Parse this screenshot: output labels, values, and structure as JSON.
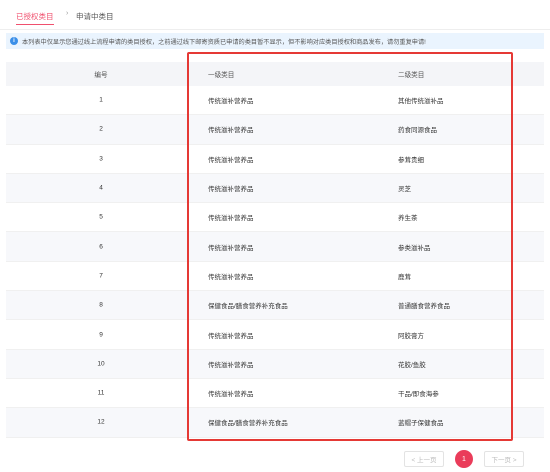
{
  "tabs": {
    "active_label": "已授权类目",
    "separator": "›",
    "inactive_label": "申请中类目"
  },
  "notice": {
    "icon": "info-icon",
    "text": "本列表中仅显示您通过线上流程申请的类目授权，之前通过线下邮寄资质已申请的类目暂不显示，但不影响对应类目授权和商品发布，请勿重复申请!"
  },
  "table": {
    "headers": {
      "id": "编号",
      "level1": "一级类目",
      "level2": "二级类目"
    },
    "rows": [
      {
        "id": "1",
        "level1": "传统滋补营养品",
        "level2": "其他传统滋补品"
      },
      {
        "id": "2",
        "level1": "传统滋补营养品",
        "level2": "药食同源食品"
      },
      {
        "id": "3",
        "level1": "传统滋补营养品",
        "level2": "参茸贵细"
      },
      {
        "id": "4",
        "level1": "传统滋补营养品",
        "level2": "灵芝"
      },
      {
        "id": "5",
        "level1": "传统滋补营养品",
        "level2": "养生茶"
      },
      {
        "id": "6",
        "level1": "传统滋补营养品",
        "level2": "参类滋补品"
      },
      {
        "id": "7",
        "level1": "传统滋补营养品",
        "level2": "鹿茸"
      },
      {
        "id": "8",
        "level1": "保健食品/膳食营养补充食品",
        "level2": "普通膳食营养食品"
      },
      {
        "id": "9",
        "level1": "传统滋补营养品",
        "level2": "阿胶膏方"
      },
      {
        "id": "10",
        "level1": "传统滋补营养品",
        "level2": "花胶/鱼胶"
      },
      {
        "id": "11",
        "level1": "传统滋补营养品",
        "level2": "干品/即食海参"
      },
      {
        "id": "12",
        "level1": "保健食品/膳食营养补充食品",
        "level2": "蓝帽子保健食品"
      }
    ]
  },
  "pagination": {
    "prev_label": "< 上一页",
    "current_page": "1",
    "next_label": "下一页 >"
  },
  "colors": {
    "accent": "#f0506e",
    "highlight_border": "#e53935",
    "info_blue": "#3b8fe8",
    "notice_bg": "#eaf4fe"
  }
}
